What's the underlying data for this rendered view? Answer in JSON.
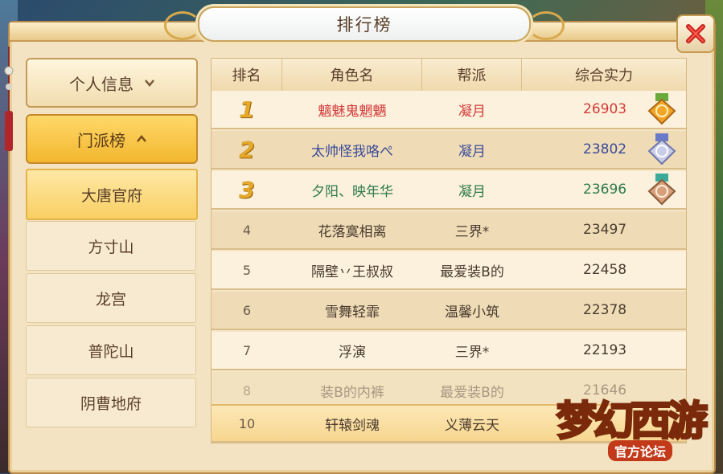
{
  "window": {
    "title": "排行榜"
  },
  "sidebar": {
    "personal_label": "个人信息",
    "school_label": "门派榜",
    "schools": [
      "大唐官府",
      "方寸山",
      "龙宫",
      "普陀山",
      "阴曹地府"
    ],
    "active_school": "大唐官府"
  },
  "table": {
    "headers": {
      "rank": "排名",
      "name": "角色名",
      "guild": "帮派",
      "power": "综合实力"
    },
    "rows": [
      {
        "rank": "1",
        "name": "魑魅鬼魍魉",
        "guild": "凝月",
        "power": "26903",
        "color": "#d43a3a",
        "medal": "gold"
      },
      {
        "rank": "2",
        "name": "太帅怪我咯ぺ",
        "guild": "凝月",
        "power": "23802",
        "color": "#3a4a9a",
        "medal": "silver"
      },
      {
        "rank": "3",
        "name": "夕阳、映年华",
        "guild": "凝月",
        "power": "23696",
        "color": "#2e7a4a",
        "medal": "bronze"
      },
      {
        "rank": "4",
        "name": "花落寞相离",
        "guild": "三界*",
        "power": "23497"
      },
      {
        "rank": "5",
        "name": "隔壁丷王叔叔",
        "guild": "最爱装B的",
        "power": "22458"
      },
      {
        "rank": "6",
        "name": "雪舞轻霏",
        "guild": "温馨小筑",
        "power": "22378"
      },
      {
        "rank": "7",
        "name": "浮演",
        "guild": "三界*",
        "power": "22193"
      },
      {
        "rank": "8",
        "name": "装B的内裤",
        "guild": "最爱装B的",
        "power": "21646"
      }
    ],
    "self_row": {
      "rank": "10",
      "name": "轩辕剑魂",
      "guild": "义薄云天",
      "power": ""
    }
  },
  "logo": {
    "main": "梦幻西游",
    "sub": "官方论坛"
  },
  "colors": {
    "accent": "#f2b72e",
    "frame": "#b98a4a"
  }
}
